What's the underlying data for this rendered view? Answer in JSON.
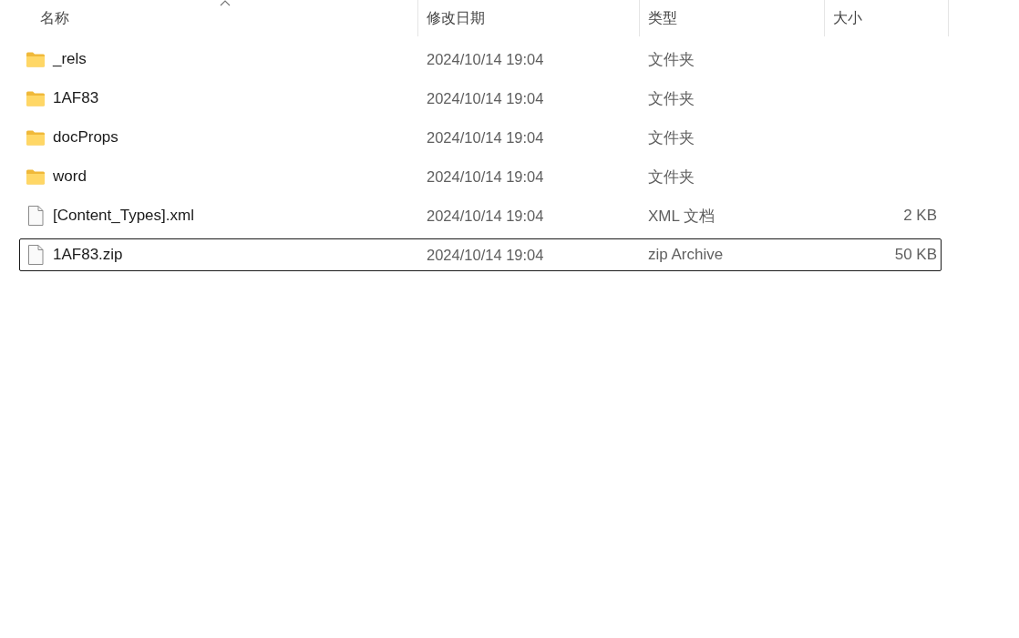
{
  "columns": [
    {
      "label": "名称",
      "sorted": true
    },
    {
      "label": "修改日期",
      "sorted": false
    },
    {
      "label": "类型",
      "sorted": false
    },
    {
      "label": "大小",
      "sorted": false
    }
  ],
  "rows": [
    {
      "kind": "folder",
      "name": "_rels",
      "modified": "2024/10/14 19:04",
      "type": "文件夹",
      "focused": false
    },
    {
      "kind": "folder",
      "name": "1AF83",
      "modified": "2024/10/14 19:04",
      "type": "文件夹",
      "focused": false
    },
    {
      "kind": "folder",
      "name": "docProps",
      "modified": "2024/10/14 19:04",
      "type": "文件夹",
      "focused": false
    },
    {
      "kind": "folder",
      "name": "word",
      "modified": "2024/10/14 19:04",
      "type": "文件夹",
      "focused": false
    },
    {
      "kind": "file",
      "name": "[Content_Types].xml",
      "modified": "2024/10/14 19:04",
      "type": "XML 文档",
      "size": "2 KB",
      "focused": false
    },
    {
      "kind": "file",
      "name": "1AF83.zip",
      "modified": "2024/10/14 19:04",
      "type": "zip Archive",
      "size": "50 KB",
      "focused": true
    }
  ]
}
